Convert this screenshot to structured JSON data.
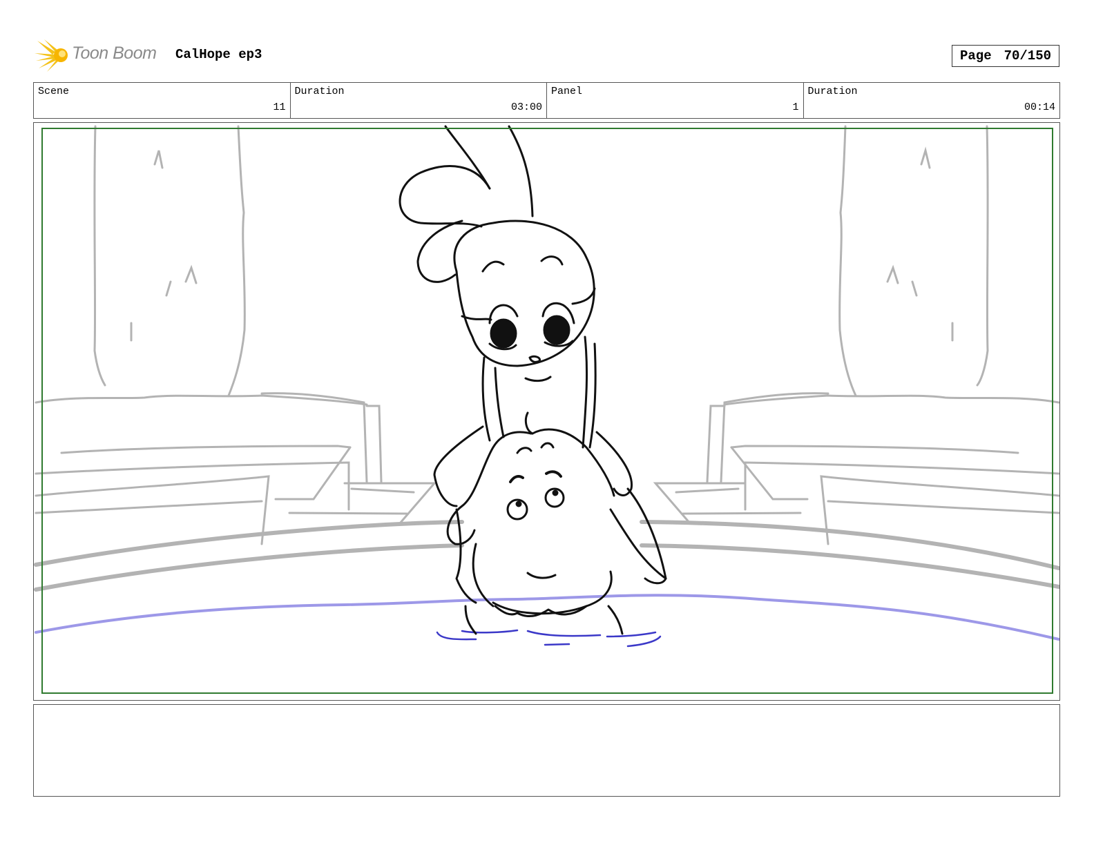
{
  "header": {
    "logo_text": "Toon Boom",
    "project_title": "CalHope ep3",
    "page_label": "Page",
    "page_number": "70/150"
  },
  "info": {
    "scene_label": "Scene",
    "scene_value": "11",
    "scene_duration_label": "Duration",
    "scene_duration_value": "03:00",
    "panel_label": "Panel",
    "panel_value": "1",
    "panel_duration_label": "Duration",
    "panel_duration_value": "00:14"
  },
  "colors": {
    "safe_frame": "#2f7a2f",
    "background_lines": "#b3b3b3",
    "character_lines": "#111111",
    "water_line": "#9d98e8",
    "ripples": "#3b38c8"
  },
  "notes": {
    "action_text": ""
  }
}
